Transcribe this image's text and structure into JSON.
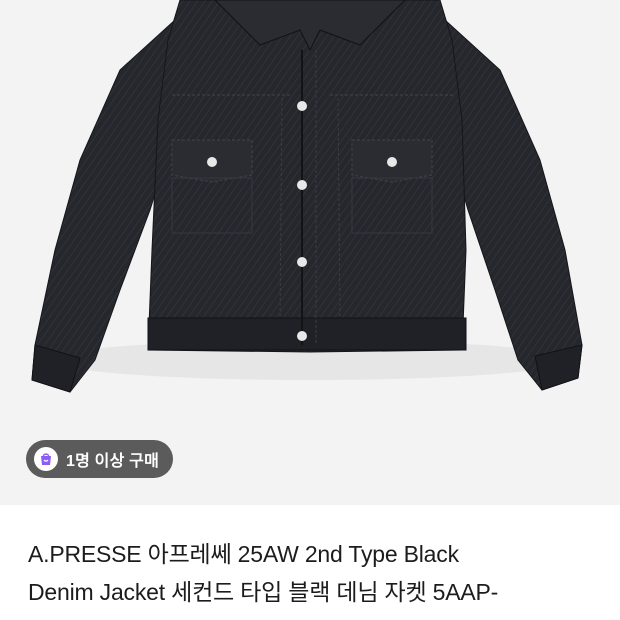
{
  "product": {
    "image_alt_icon": "jacket-photo",
    "buyers_badge": {
      "icon": "shopping-bag-icon",
      "icon_color": "#8b5cf6",
      "label": "1명 이상 구매"
    },
    "title_line1": "A.PRESSE 아프레쎄 25AW 2nd Type Black",
    "title_line2": "Denim Jacket 세컨드 타입 블랙 데님 자켓 5AAP-"
  },
  "colors": {
    "image_background": "#f3f3f3",
    "denim": "#25272c",
    "badge_background": "#5b5b5b",
    "title_text": "#1c1c1c"
  }
}
